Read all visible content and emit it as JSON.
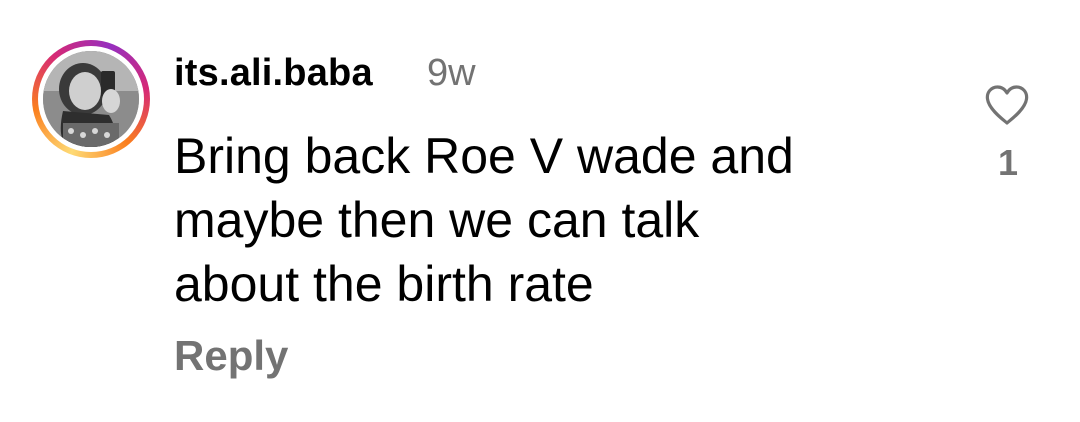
{
  "comment": {
    "username": "its.ali.baba",
    "timestamp": "9w",
    "text_lines": [
      "Bring back Roe V wade and",
      "maybe then we can talk",
      "about the birth rate"
    ],
    "reply_label": "Reply",
    "like_count": "1",
    "like_icon": "heart-outline-icon",
    "colors": {
      "text": "#000000",
      "muted": "#737373",
      "ring_gradient": [
        "#feda75",
        "#fa7e1e",
        "#d62976",
        "#962fbf"
      ]
    }
  }
}
